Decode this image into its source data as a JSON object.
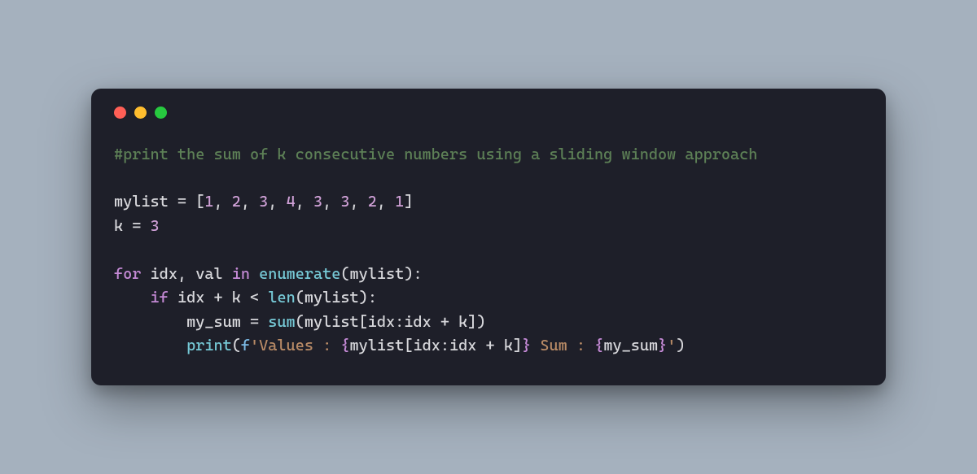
{
  "colors": {
    "background": "#a5b1be",
    "window_bg": "#1e1f29",
    "traffic_red": "#ff5f56",
    "traffic_yellow": "#ffbd2e",
    "traffic_green": "#27c93f",
    "comment": "#5d8056",
    "identifier": "#d7d7db",
    "number": "#cfa0d6",
    "keyword": "#c58ad6",
    "builtin": "#76c9d6",
    "string": "#b98b66",
    "fprefix": "#7cbbe6"
  },
  "code": {
    "line1_comment": "#print the sum of k consecutive numbers using a sliding window approach",
    "line3": {
      "mylist": "mylist",
      "eq": " = ",
      "lb": "[",
      "n1": "1",
      "c1": ", ",
      "n2": "2",
      "c2": ", ",
      "n3": "3",
      "c3": ", ",
      "n4": "4",
      "c4": ", ",
      "n5": "3",
      "c5": ", ",
      "n6": "3",
      "c6": ", ",
      "n7": "2",
      "c7": ", ",
      "n8": "1",
      "rb": "]"
    },
    "line4": {
      "k": "k",
      "eq": " = ",
      "val": "3"
    },
    "line6": {
      "for": "for",
      "sp1": " ",
      "idx": "idx",
      "comma": ", ",
      "val": "val",
      "sp2": " ",
      "in": "in",
      "sp3": " ",
      "enumerate": "enumerate",
      "lp": "(",
      "mylist": "mylist",
      "rp": ")",
      "colon": ":"
    },
    "line7": {
      "indent": "    ",
      "if": "if",
      "sp1": " ",
      "idx": "idx",
      "sp2": " ",
      "plus": "+",
      "sp3": " ",
      "k": "k",
      "sp4": " ",
      "lt": "<",
      "sp5": " ",
      "len": "len",
      "lp": "(",
      "mylist": "mylist",
      "rp": ")",
      "colon": ":"
    },
    "line8": {
      "indent": "        ",
      "my_sum": "my_sum",
      "eq": " = ",
      "sum": "sum",
      "lp": "(",
      "mylist": "mylist",
      "lb": "[",
      "idx1": "idx",
      "colon": ":",
      "idx2": "idx",
      "sp1": " ",
      "plus": "+",
      "sp2": " ",
      "k": "k",
      "rb": "]",
      "rp": ")"
    },
    "line9": {
      "indent": "        ",
      "print": "print",
      "lp": "(",
      "fpref": "f",
      "q1": "'",
      "s1": "Values : ",
      "lb1": "{",
      "mylist": "mylist",
      "ib": "[",
      "idx1": "idx",
      "col": ":",
      "idx2": "idx",
      "sp1": " ",
      "plus": "+",
      "sp2": " ",
      "k": "k",
      "irb": "]",
      "rb1": "}",
      "s2": " Sum : ",
      "lb2": "{",
      "my_sum": "my_sum",
      "rb2": "}",
      "q2": "'",
      "rp": ")"
    }
  }
}
